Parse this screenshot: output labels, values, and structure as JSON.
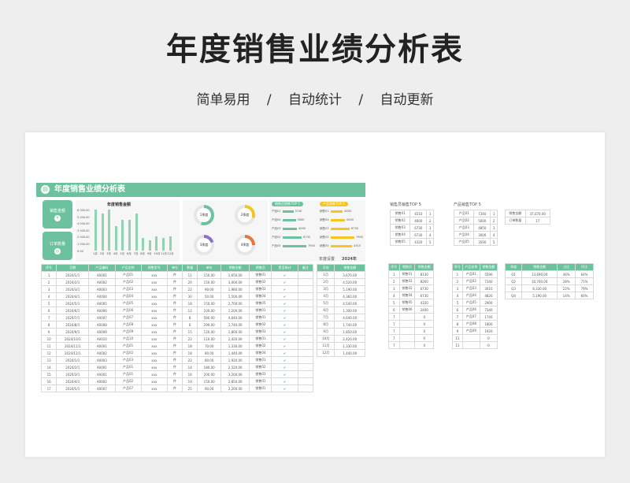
{
  "hero": {
    "title": "年度销售业绩分析表",
    "tags": [
      "简单易用",
      "自动统计",
      "自动更新"
    ],
    "separator": "/"
  },
  "dash": {
    "title": "年度销售业绩分析表",
    "kpi1": "销售金额",
    "kpi2": "订单数量",
    "bar_title": "年度销售金额",
    "ylabels": [
      "6 000.00",
      "5 000.00",
      "4 000.00",
      "3 000.00",
      "2 000.00",
      "1 000.00",
      "0.00"
    ],
    "months": [
      "1月",
      "2月",
      "3月",
      "4月",
      "5月",
      "6月",
      "7月",
      "8月",
      "9月",
      "10月",
      "11月",
      "12月"
    ],
    "bars": [
      1,
      0.9,
      1,
      0.6,
      0.75,
      0.75,
      0.9,
      0.3,
      0.25,
      0.35,
      0.3,
      0.35
    ],
    "quarters": [
      {
        "label": "1季度",
        "pct": 0.55,
        "color": "#6cc29f"
      },
      {
        "label": "2季度",
        "pct": 0.3,
        "color": "#f5c422"
      },
      {
        "label": "3季度",
        "pct": 0.2,
        "color": "#8c6fd1"
      },
      {
        "label": "4季度",
        "pct": 0.25,
        "color": "#e8743b"
      }
    ],
    "top1": {
      "title": "销售员销售TOP 5",
      "names": [
        "产品01",
        "产品04",
        "产品03",
        "产品02",
        "产品05"
      ],
      "vals": [
        "3740",
        "3000",
        "4000",
        "6730",
        "7900"
      ],
      "fill": [
        0.45,
        0.55,
        0.6,
        0.8,
        1
      ]
    },
    "top2": {
      "title": "产品销售TOP 5",
      "names": [
        "销售01",
        "销售04",
        "销售03",
        "销售02",
        "销售05"
      ],
      "vals": [
        "4000",
        "5000",
        "6730",
        "7900",
        "4315"
      ],
      "fill": [
        0.5,
        0.6,
        0.8,
        1,
        0.9
      ]
    },
    "year_label": "年度设置",
    "year": "2024年"
  },
  "main_table": {
    "headers": [
      "序号",
      "日期",
      "产品编码",
      "产品名称",
      "销售型号",
      "单位",
      "数量",
      "单价",
      "销售金额",
      "销售员",
      "是否统计",
      "备注"
    ],
    "rows": [
      [
        "1",
        "2024/1/1",
        "A0001",
        "产品01",
        "xxx",
        "件",
        "11",
        "150.00",
        "1,650.00",
        "销售01",
        "✔",
        ""
      ],
      [
        "2",
        "2024/2/1",
        "A0002",
        "产品02",
        "xxx",
        "件",
        "20",
        "150.00",
        "3,000.00",
        "销售02",
        "✔",
        ""
      ],
      [
        "3",
        "2024/3/1",
        "A0003",
        "产品03",
        "xxx",
        "件",
        "22",
        "90.00",
        "1,980.00",
        "销售03",
        "✔",
        ""
      ],
      [
        "4",
        "2024/4/1",
        "A0004",
        "产品04",
        "xxx",
        "件",
        "30",
        "50.00",
        "1,500.00",
        "销售04",
        "✔",
        ""
      ],
      [
        "5",
        "2024/5/1",
        "A0005",
        "产品05",
        "xxx",
        "件",
        "18",
        "150.00",
        "2,700.00",
        "销售05",
        "✔",
        ""
      ],
      [
        "6",
        "2024/6/1",
        "A0006",
        "产品06",
        "xxx",
        "件",
        "12",
        "100.00",
        "1,200.00",
        "销售01",
        "✔",
        ""
      ],
      [
        "7",
        "2024/7/1",
        "A0007",
        "产品07",
        "xxx",
        "件",
        "8",
        "580.00",
        "4,640.00",
        "销售01",
        "✔",
        ""
      ],
      [
        "8",
        "2024/8/1",
        "A0008",
        "产品08",
        "xxx",
        "件",
        "6",
        "290.00",
        "1,740.00",
        "销售02",
        "✔",
        ""
      ],
      [
        "9",
        "2024/9/1",
        "A0009",
        "产品09",
        "xxx",
        "件",
        "15",
        "120.00",
        "1,800.00",
        "销售03",
        "✔",
        ""
      ],
      [
        "10",
        "2024/10/1",
        "A0010",
        "产品10",
        "xxx",
        "件",
        "22",
        "110.00",
        "2,420.00",
        "销售01",
        "✔",
        ""
      ],
      [
        "11",
        "2024/11/1",
        "A0001",
        "产品01",
        "xxx",
        "件",
        "18",
        "70.00",
        "1,330.00",
        "销售02",
        "✔",
        ""
      ],
      [
        "12",
        "2024/12/1",
        "A0002",
        "产品02",
        "xxx",
        "件",
        "18",
        "80.00",
        "1,440.00",
        "销售04",
        "✔",
        ""
      ],
      [
        "13",
        "2024/1/1",
        "A0003",
        "产品03",
        "xxx",
        "件",
        "22",
        "80.00",
        "1,920.00",
        "销售01",
        "✔",
        ""
      ],
      [
        "14",
        "2024/2/1",
        "A0001",
        "产品01",
        "xxx",
        "件",
        "14",
        "180.00",
        "2,520.00",
        "销售02",
        "✔",
        ""
      ],
      [
        "15",
        "2024/3/1",
        "A0001",
        "产品01",
        "xxx",
        "件",
        "16",
        "200.00",
        "3,200.00",
        "销售03",
        "✔",
        ""
      ],
      [
        "16",
        "2024/4/1",
        "A0002",
        "产品02",
        "xxx",
        "件",
        "19",
        "150.00",
        "2,850.00",
        "销售01",
        "✔",
        ""
      ],
      [
        "17",
        "2024/5/1",
        "A0007",
        "产品07",
        "xxx",
        "件",
        "25",
        "90.00",
        "2,200.00",
        "销售01",
        "✔",
        ""
      ]
    ]
  },
  "month_table": {
    "headers": [
      "月份",
      "销售金额"
    ],
    "rows": [
      [
        "1月",
        "3,670.00"
      ],
      [
        "2月",
        "4,520.00"
      ],
      [
        "3月",
        "5,190.00"
      ],
      [
        "4月",
        "4,360.00"
      ],
      [
        "5月",
        "4,540.00"
      ],
      [
        "6月",
        "1,300.00"
      ],
      [
        "7月",
        "4,640.00"
      ],
      [
        "8月",
        "1,740.00"
      ],
      [
        "9月",
        "1,850.00"
      ],
      [
        "10月",
        "2,420.00"
      ],
      [
        "11月",
        "1,330.00"
      ],
      [
        "12月",
        "1,440.00"
      ]
    ]
  },
  "r_top1": {
    "caption": "销售员销售TOP 5",
    "rows": [
      [
        "销售01",
        "4510",
        "1"
      ],
      [
        "销售02",
        "4000",
        "2"
      ],
      [
        "销售03",
        "6730",
        "3"
      ],
      [
        "销售04",
        "6730",
        "4"
      ],
      [
        "销售05",
        "4320",
        "5"
      ]
    ]
  },
  "r_top2": {
    "caption": "产品销售TOP 5",
    "rows": [
      [
        "产品01",
        "7340",
        "1"
      ],
      [
        "产品02",
        "5000",
        "2"
      ],
      [
        "产品03",
        "4850",
        "3"
      ],
      [
        "产品04",
        "3000",
        "4"
      ],
      [
        "产品05",
        "3590",
        "5"
      ]
    ]
  },
  "r_sum": {
    "rows": [
      [
        "销售金额",
        "37,670.00"
      ],
      [
        "订单数量",
        "17"
      ]
    ]
  },
  "r_sales": {
    "headers": [
      "序号",
      "销售员",
      "销售金额"
    ],
    "rows": [
      [
        "1",
        "销售01",
        "8130"
      ],
      [
        "2",
        "销售02",
        "8260"
      ],
      [
        "3",
        "销售03",
        "6730"
      ],
      [
        "4",
        "销售04",
        "6730"
      ],
      [
        "5",
        "销售05",
        "4320"
      ],
      [
        "6",
        "销售06",
        "2400"
      ],
      [
        "7",
        "",
        "0"
      ],
      [
        "7",
        "",
        "0"
      ],
      [
        "7",
        "",
        "0"
      ],
      [
        "7",
        "",
        "0"
      ],
      [
        "7",
        "",
        "0"
      ]
    ]
  },
  "r_prod": {
    "headers": [
      "序号",
      "产品名称",
      "销售金额"
    ],
    "rows": [
      [
        "1",
        "产品01",
        "5590"
      ],
      [
        "2",
        "产品02",
        "7340"
      ],
      [
        "3",
        "产品03",
        "3010"
      ],
      [
        "4",
        "产品04",
        "4820"
      ],
      [
        "5",
        "产品05",
        "2900"
      ],
      [
        "6",
        "产品06",
        "7340"
      ],
      [
        "7",
        "产品07",
        "1740"
      ],
      [
        "8",
        "产品08",
        "1800"
      ],
      [
        "9",
        "产品09",
        "1920"
      ],
      [
        "11",
        "",
        "0"
      ],
      [
        "11",
        "",
        "0"
      ]
    ]
  },
  "r_q": {
    "headers": [
      "季度",
      "销售金额",
      "占比",
      "环比"
    ],
    "rows": [
      [
        "Q1",
        "13,690.00",
        "36%",
        "64%"
      ],
      [
        "Q2",
        "10,700.00",
        "28%",
        "71%"
      ],
      [
        "Q3",
        "8,330.00",
        "22%",
        "79%"
      ],
      [
        "Q4",
        "5,190.00",
        "14%",
        "60%"
      ]
    ]
  }
}
